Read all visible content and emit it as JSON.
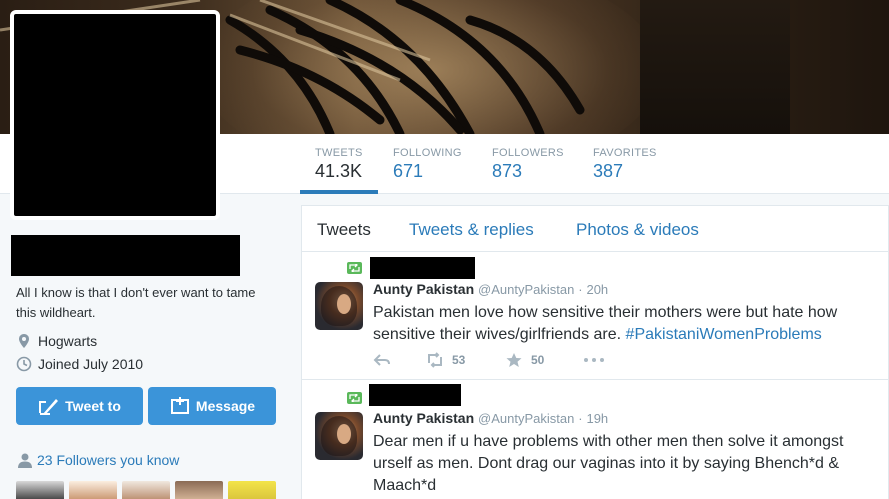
{
  "profile": {
    "bio": "All I know is that I don't ever want to tame this wildheart.",
    "location": "Hogwarts",
    "joined": "Joined July 2010",
    "location_icon": "map-pin-icon",
    "calendar_icon": "calendar-icon"
  },
  "stats": [
    {
      "label": "TWEETS",
      "value": "41.3K"
    },
    {
      "label": "FOLLOWING",
      "value": "671"
    },
    {
      "label": "FOLLOWERS",
      "value": "873"
    },
    {
      "label": "FAVORITES",
      "value": "387"
    }
  ],
  "buttons": {
    "tweet_to": "Tweet to",
    "message": "Message"
  },
  "followers_you_know": "23 Followers you know",
  "tabs": [
    "Tweets",
    "Tweets & replies",
    "Photos & videos"
  ],
  "tweets": [
    {
      "fullname": "Aunty Pakistan",
      "screenname": "@AuntyPakistan",
      "dot": "·",
      "time": "20h",
      "text": "Pakistan men love how sensitive their mothers were but hate how sensitive their wives/girlfriends are.",
      "hashtag": "#PakistaniWomenProblems",
      "retweets": "53",
      "favorites": "50"
    },
    {
      "fullname": "Aunty Pakistan",
      "screenname": "@AuntyPakistan",
      "dot": "·",
      "time": "19h",
      "text": "Dear men if u have problems with other men then solve it amongst urself as men. Dont drag our vaginas into it by saying Bhench*d & Maach*d",
      "hashtag": "",
      "retweets": "",
      "favorites": ""
    }
  ],
  "colors": {
    "accent": "#2b7bb9",
    "button": "#3b94d9",
    "retweet_badge": "#5ab85a",
    "muted": "#8899a6"
  }
}
